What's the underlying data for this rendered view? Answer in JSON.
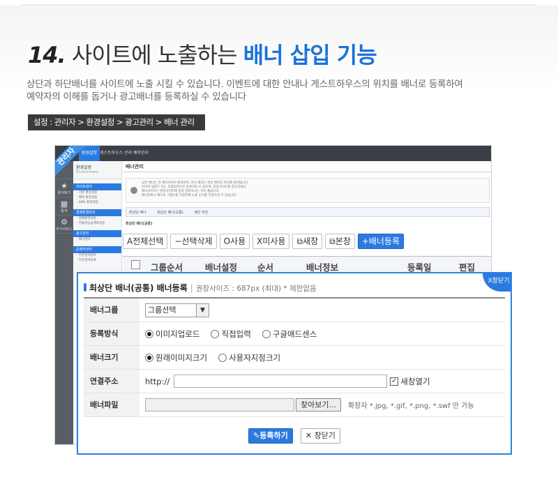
{
  "header": {
    "num": "14.",
    "title_plain": " 사이트에 노출하는 ",
    "title_highlight": "배너 삽입 기능"
  },
  "description": {
    "line1": "상단과 하단배너를 사이트에 노출 시킬 수 있습니다.  이벤트에 대한 안내나 게스트하우스의 위치를 배너로 등록하여",
    "line2": "예약자의 이해를 돕거나 광고배너를 등록하실 수 있습니다"
  },
  "path": "설정 : 관리자 > 환경설정 > 광고관리 > 배너 관리",
  "admin": {
    "ribbon": "관리자",
    "top_tabs": [
      "환경설정",
      "게스트하우스 관리",
      "예약관리"
    ],
    "left_items": [
      {
        "icon": "★",
        "label": "즐겨찾기"
      },
      {
        "icon": "▦",
        "label": "통계"
      },
      {
        "icon": "⚙",
        "label": "부가서비스"
      }
    ],
    "side": {
      "title": "환경설정",
      "subtitle": "Environment",
      "sections": [
        {
          "label": "사이트관리",
          "items": [
            "· 기본 환경설정",
            "· 예약 환경설정",
            "· SMS 환경설정"
          ]
        },
        {
          "label": "결제환경관리",
          "items": [
            "· 결제환경설정",
            "· 무통장입금계좌설정"
          ]
        },
        {
          "label": "광고관리",
          "items": [
            "· 배너관리"
          ]
        },
        {
          "label": "운영자관리",
          "items": [
            "· 부운영자관리",
            "· 부운영자등록"
          ]
        }
      ]
    },
    "main_title": "배너관리",
    "notice_lines": [
      "상단 배너는 전 페이지에서 출력되며, 하단 배너는 메인 페이지 하단에 출력됩니다.",
      "이미지 업로드 또는 직접입력으로 등록하실 수 있으며, 권장사이즈를 참고하세요.",
      "배너사이즈는 권장사이즈에 맞춰 설정하시는 것이 좋습니다.",
      "배너등록시 배너의 그룹순을 지정하여 노출 순서를 조정하실 수 있습니다."
    ],
    "sub_tabs": [
      "최상단 배너",
      "최상단 배너(공통)",
      "메인 하단"
    ],
    "group_label": "최상단 배너(공통)",
    "toolbar": [
      "A전체선택",
      "−선택삭제",
      "O사용",
      "X미사용",
      "⧉새창",
      "⧉본창",
      "+배너등록"
    ],
    "columns": [
      "그룹순서",
      "배너설정",
      "순서",
      "배너정보",
      "등록일",
      "편집"
    ]
  },
  "popup": {
    "title": "최상단 배너(공통) 배너등록",
    "subtitle": "권장사이즈 : 687px (최대) * 제한없음",
    "close_label": "X창닫기",
    "rows": {
      "group": {
        "label": "배너그룹",
        "select_value": "그룹선택"
      },
      "method": {
        "label": "등록방식",
        "options": [
          "이미지업로드",
          "직접입력",
          "구글애드센스"
        ],
        "selected": 0
      },
      "size": {
        "label": "배너크기",
        "options": [
          "원래이미지크기",
          "사용자지정크기"
        ],
        "selected": 0
      },
      "link": {
        "label": "연결주소",
        "prefix": "http://",
        "value": "",
        "checkbox_label": "새창열기",
        "checked": true
      },
      "file": {
        "label": "배너파일",
        "button": "찾아보기...",
        "note": "확장자 *.jpg, *.gif, *.png, *.swf 만 가능"
      }
    },
    "submit": "등록하기",
    "close": "창닫기"
  }
}
